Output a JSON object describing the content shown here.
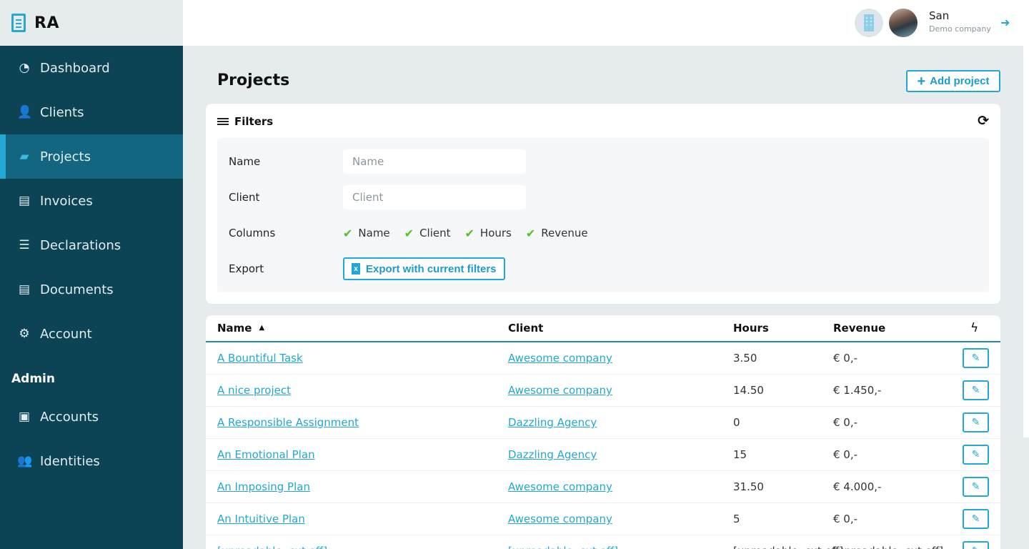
{
  "brand": {
    "name": "RA",
    "logo_icon": "receipt-icon"
  },
  "sidebar": {
    "items": [
      {
        "label": "Dashboard",
        "icon": "tachometer-icon",
        "active": false
      },
      {
        "label": "Clients",
        "icon": "user-tie-icon",
        "active": false
      },
      {
        "label": "Projects",
        "icon": "folder-open-icon",
        "active": true
      },
      {
        "label": "Invoices",
        "icon": "invoice-dollar-icon",
        "active": false
      },
      {
        "label": "Declarations",
        "icon": "receipt-icon",
        "active": false
      },
      {
        "label": "Documents",
        "icon": "document-icon",
        "active": false
      },
      {
        "label": "Account",
        "icon": "gear-icon",
        "active": false
      }
    ],
    "admin_section": {
      "title": "Admin",
      "items": [
        {
          "label": "Accounts",
          "icon": "user-file-icon"
        },
        {
          "label": "Identities",
          "icon": "users-icon"
        }
      ]
    }
  },
  "topbar": {
    "user_name": "San",
    "company": "Demo company",
    "company_icon": "building-icon",
    "logout_icon": "sign-out-icon"
  },
  "page": {
    "title": "Projects",
    "add_button": "Add project"
  },
  "filters": {
    "title": "Filters",
    "name_label": "Name",
    "name_placeholder": "Name",
    "name_value": "",
    "client_label": "Client",
    "client_placeholder": "Client",
    "client_value": "",
    "columns_label": "Columns",
    "columns": [
      {
        "label": "Name",
        "checked": true
      },
      {
        "label": "Client",
        "checked": true
      },
      {
        "label": "Hours",
        "checked": true
      },
      {
        "label": "Revenue",
        "checked": true
      }
    ],
    "export_label": "Export",
    "export_button": "Export with current filters"
  },
  "table": {
    "headers": {
      "name": "Name",
      "client": "Client",
      "hours": "Hours",
      "revenue": "Revenue",
      "actions_icon": "bolt-icon"
    },
    "sort": {
      "column": "name",
      "direction": "asc"
    },
    "rows": [
      {
        "name": "A Bountiful Task",
        "client": "Awesome company",
        "hours": "3.50",
        "revenue": "€ 0,-"
      },
      {
        "name": "A nice project",
        "client": "Awesome company",
        "hours": "14.50",
        "revenue": "€ 1.450,-"
      },
      {
        "name": "A Responsible Assignment",
        "client": "Dazzling Agency",
        "hours": "0",
        "revenue": "€ 0,-"
      },
      {
        "name": "An Emotional Plan",
        "client": "Dazzling Agency",
        "hours": "15",
        "revenue": "€ 0,-"
      },
      {
        "name": "An Imposing Plan",
        "client": "Awesome company",
        "hours": "31.50",
        "revenue": "€ 4.000,-"
      },
      {
        "name": "An Intuitive Plan",
        "client": "Awesome company",
        "hours": "5",
        "revenue": "€ 0,-"
      },
      {
        "name": "[unreadable, cut off]",
        "client": "[unreadable, cut off]",
        "hours": "[unreadable, cut off]",
        "revenue": "[unreadable, cut off]"
      }
    ]
  }
}
